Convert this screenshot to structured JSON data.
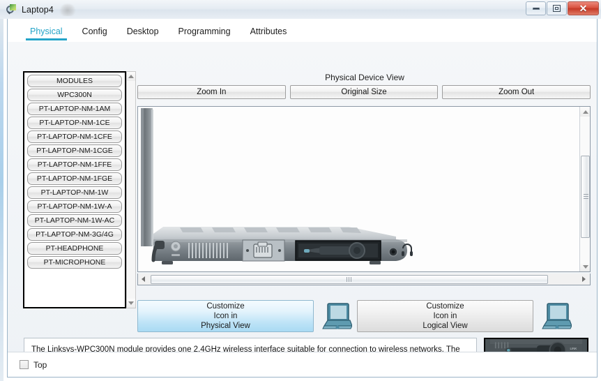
{
  "window": {
    "title": "Laptop4",
    "icon": "packet-tracer-icon",
    "controls": {
      "minimize": "–",
      "maximize": "□",
      "close": "✕"
    }
  },
  "tabs": [
    {
      "label": "Physical",
      "active": true
    },
    {
      "label": "Config",
      "active": false
    },
    {
      "label": "Desktop",
      "active": false
    },
    {
      "label": "Programming",
      "active": false
    },
    {
      "label": "Attributes",
      "active": false
    }
  ],
  "modules": {
    "header": "MODULES",
    "items": [
      "MODULES",
      "WPC300N",
      "PT-LAPTOP-NM-1AM",
      "PT-LAPTOP-NM-1CE",
      "PT-LAPTOP-NM-1CFE",
      "PT-LAPTOP-NM-1CGE",
      "PT-LAPTOP-NM-1FFE",
      "PT-LAPTOP-NM-1FGE",
      "PT-LAPTOP-NM-1W",
      "PT-LAPTOP-NM-1W-A",
      "PT-LAPTOP-NM-1W-AC",
      "PT-LAPTOP-NM-3G/4G",
      "PT-HEADPHONE",
      "PT-MICROPHONE"
    ]
  },
  "device_view": {
    "title": "Physical Device View",
    "zoom_in": "Zoom In",
    "original_size": "Original Size",
    "zoom_out": "Zoom Out"
  },
  "customize": {
    "physical": {
      "line1": "Customize",
      "line2": "Icon in",
      "line3": "Physical View"
    },
    "logical": {
      "line1": "Customize",
      "line2": "Icon in",
      "line3": "Logical View"
    }
  },
  "description": "The Linksys-WPC300N module provides one 2.4GHz wireless interface suitable for connection to wireless networks. The module supports protocols that use Ethernet for LAN access.",
  "module_image_label": "LINK",
  "footer": {
    "top_label": "Top",
    "top_checked": false
  },
  "colors": {
    "accent": "#23a4c8",
    "close_button": "#c53a27",
    "customize_selected": "#bfe4f7",
    "laptop_icon": "#4e8ca4"
  }
}
